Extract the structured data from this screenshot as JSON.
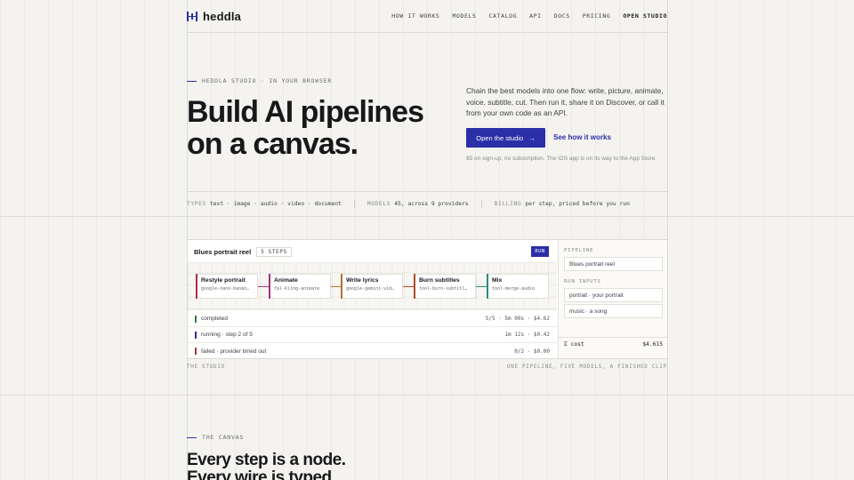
{
  "brand": {
    "name": "heddla",
    "accent": "#2a2fa8"
  },
  "nav": {
    "links": [
      "HOW IT WORKS",
      "MODELS",
      "CATALOG",
      "API",
      "DOCS",
      "PRICING"
    ],
    "cta": "OPEN STUDIO"
  },
  "hero": {
    "eyebrow": "HEDDLA STUDIO · IN YOUR BROWSER",
    "title_line1": "Build AI pipelines",
    "title_line2": "on a canvas.",
    "description": "Chain the best models into one flow: write, picture, animate, voice, subtitle, cut. Then run it, share it on Discover, or call it from your own code as an API.",
    "primary_button": "Open the studio",
    "secondary_link": "See how it works",
    "note": "$5 on sign-up, no subscription. The iOS app is on its way to the App Store."
  },
  "stats": [
    {
      "key": "TYPES",
      "value": "text · image · audio · video · document"
    },
    {
      "key": "MODELS",
      "value": "45, across 9 providers"
    },
    {
      "key": "BILLING",
      "value": "per step, priced before you run"
    }
  ],
  "studio": {
    "pipeline_title": "Blues portrait reel",
    "steps_badge": "5 STEPS",
    "run_label": "RUN",
    "nodes": [
      {
        "title": "Restyle portrait",
        "model": "google-nano-banan…",
        "color": "#a8323a"
      },
      {
        "title": "Animate",
        "model": "fal-kling-animate",
        "color": "#a3337a"
      },
      {
        "title": "Write lyrics",
        "model": "google-gemini-vid…",
        "color": "#b0752a"
      },
      {
        "title": "Burn subtitles",
        "model": "tool-burn-subtitl…",
        "color": "#b04a2a"
      },
      {
        "title": "Mix",
        "model": "tool-merge-audio",
        "color": "#2a8a7a"
      }
    ],
    "runs": [
      {
        "status": "completed",
        "meta": "5/5 · 5m 00s · $4.62",
        "color": "#2f7a3a"
      },
      {
        "status": "running · step 2 of 5",
        "meta": "1m 12s · $0.42",
        "color": "#2a2fa8"
      },
      {
        "status": "failed · provider timed out",
        "meta": "0/2 · $0.00",
        "color": "#a8323a"
      }
    ],
    "side": {
      "pipeline_label": "PIPELINE",
      "pipeline_value": "Blues portrait reel",
      "inputs_label": "RUN INPUTS",
      "input_1": "portrait · your portrait",
      "input_2": "music · a song",
      "cost_label": "Σ cost",
      "cost_value": "$4.615"
    },
    "caption_left": "THE STUDIO",
    "caption_right": "ONE PIPELINE, FIVE MODELS, A FINISHED CLIP"
  },
  "section2": {
    "eyebrow": "THE CANVAS",
    "title_line1": "Every step is a node.",
    "title_line2": "Every wire is typed."
  }
}
